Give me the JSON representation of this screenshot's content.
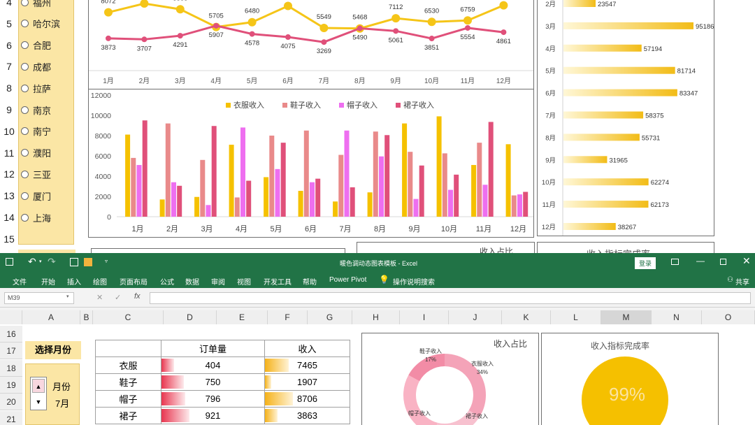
{
  "cities": [
    "福州",
    "哈尔滨",
    "合肥",
    "成都",
    "拉萨",
    "南京",
    "南宁",
    "濮阳",
    "三亚",
    "厦门",
    "上海"
  ],
  "top_row_numbers": [
    "4",
    "5",
    "6",
    "7",
    "8",
    "9",
    "10",
    "11",
    "12",
    "13",
    "14",
    "15",
    "16"
  ],
  "line_chart": {
    "months": [
      "1月",
      "2月",
      "3月",
      "4月",
      "5月",
      "6月",
      "7月",
      "8月",
      "9月",
      "10月",
      "11月",
      "12月"
    ],
    "series_yellow_labels": [
      "8072",
      "",
      "8565",
      "5705",
      "6480",
      "",
      "5549",
      "5468",
      "7112",
      "6530",
      "6759",
      ""
    ],
    "series_yellow": [
      8072,
      10200,
      8565,
      5705,
      6480,
      9100,
      5549,
      5468,
      7112,
      6530,
      6759,
      9200
    ],
    "series_pink_labels": [
      "3873",
      "3707",
      "4291",
      "5907",
      "4578",
      "4075",
      "3269",
      "5490",
      "5061",
      "3851",
      "5554",
      "4861"
    ],
    "series_pink": [
      3873,
      3707,
      4291,
      5907,
      4578,
      4075,
      3269,
      5490,
      5061,
      3851,
      5554,
      4861
    ]
  },
  "bar_chart": {
    "legend": [
      "衣服收入",
      "鞋子收入",
      "帽子收入",
      "裙子收入"
    ],
    "colors": [
      "#f5c100",
      "#e98a8a",
      "#ee6ff0",
      "#e0507a"
    ],
    "y_ticks": [
      "0",
      "2000",
      "4000",
      "6000",
      "8000",
      "10000",
      "12000"
    ],
    "ylim": [
      0,
      12000
    ],
    "months": [
      "1月",
      "2月",
      "3月",
      "4月",
      "5月",
      "6月",
      "7月",
      "8月",
      "9月",
      "10月",
      "11月",
      "12月"
    ],
    "series": [
      {
        "name": "衣服收入",
        "values": [
          8100,
          1700,
          1950,
          7100,
          3900,
          2550,
          1500,
          2400,
          9200,
          9900,
          5100,
          7150
        ]
      },
      {
        "name": "鞋子收入",
        "values": [
          5800,
          9200,
          5600,
          1900,
          8000,
          8500,
          6100,
          8400,
          6400,
          6250,
          7300,
          2100
        ]
      },
      {
        "name": "帽子收入",
        "values": [
          5100,
          3400,
          1150,
          8800,
          4700,
          3400,
          8500,
          5950,
          1750,
          2650,
          3150,
          2200
        ]
      },
      {
        "name": "裙子收入",
        "values": [
          9500,
          3050,
          8950,
          3550,
          7300,
          3750,
          2900,
          8050,
          5050,
          4150,
          9350,
          2450
        ]
      }
    ]
  },
  "hbar_chart": {
    "months": [
      "2月",
      "3月",
      "4月",
      "5月",
      "6月",
      "7月",
      "8月",
      "9月",
      "10月",
      "11月",
      "12月"
    ],
    "values": [
      23547,
      95186,
      57194,
      81714,
      83347,
      58375,
      55731,
      31965,
      62274,
      62173,
      38267
    ],
    "labels": [
      "23547",
      "95186",
      "57194",
      "81714",
      "83347",
      "58375",
      "55731",
      "31965",
      "62274",
      "62173",
      "38267"
    ]
  },
  "top_peek": {
    "title_income_share": "收入占比",
    "title_target": "收入指标完成率"
  },
  "excel": {
    "title": "暖色调动态图表模板  -  Excel",
    "login": "登录",
    "share": "共享",
    "menu": [
      "文件",
      "开始",
      "插入",
      "绘图",
      "页面布局",
      "公式",
      "数据",
      "审阅",
      "视图",
      "开发工具",
      "帮助",
      "Power Pivot",
      "操作说明搜索"
    ],
    "name_box": "M39",
    "columns": [
      "A",
      "B",
      "C",
      "D",
      "E",
      "F",
      "G",
      "H",
      "I",
      "J",
      "K",
      "L",
      "M",
      "N",
      "O"
    ],
    "rows": [
      "16",
      "17",
      "18",
      "19",
      "20",
      "21"
    ],
    "select_month_label": "选择月份",
    "month_spinner_label": "月份",
    "month_value": "7月",
    "table_headers": [
      "订单量",
      "收入"
    ],
    "table_rows": [
      {
        "item": "衣服",
        "orders": "404",
        "income": "7465",
        "orders_pct": 0.44,
        "income_pct": 0.86
      },
      {
        "item": "鞋子",
        "orders": "750",
        "income": "1907",
        "orders_pct": 0.81,
        "income_pct": 0.22
      },
      {
        "item": "帽子",
        "orders": "796",
        "income": "8706",
        "orders_pct": 0.86,
        "income_pct": 1.0
      },
      {
        "item": "裙子",
        "orders": "921",
        "income": "3863",
        "orders_pct": 1.0,
        "income_pct": 0.44
      }
    ],
    "donut_title": "收入占比",
    "donut_labels": [
      {
        "name": "鞋子收入",
        "pct": "17%"
      },
      {
        "name": "衣服收入",
        "pct": "34%"
      },
      {
        "name": "帽子收入",
        "pct": ""
      },
      {
        "name": "裙子收入",
        "pct": ""
      }
    ],
    "gauge_title": "收入指标完成率",
    "gauge_value": "99%",
    "gauge_fraction": 0.99
  }
}
